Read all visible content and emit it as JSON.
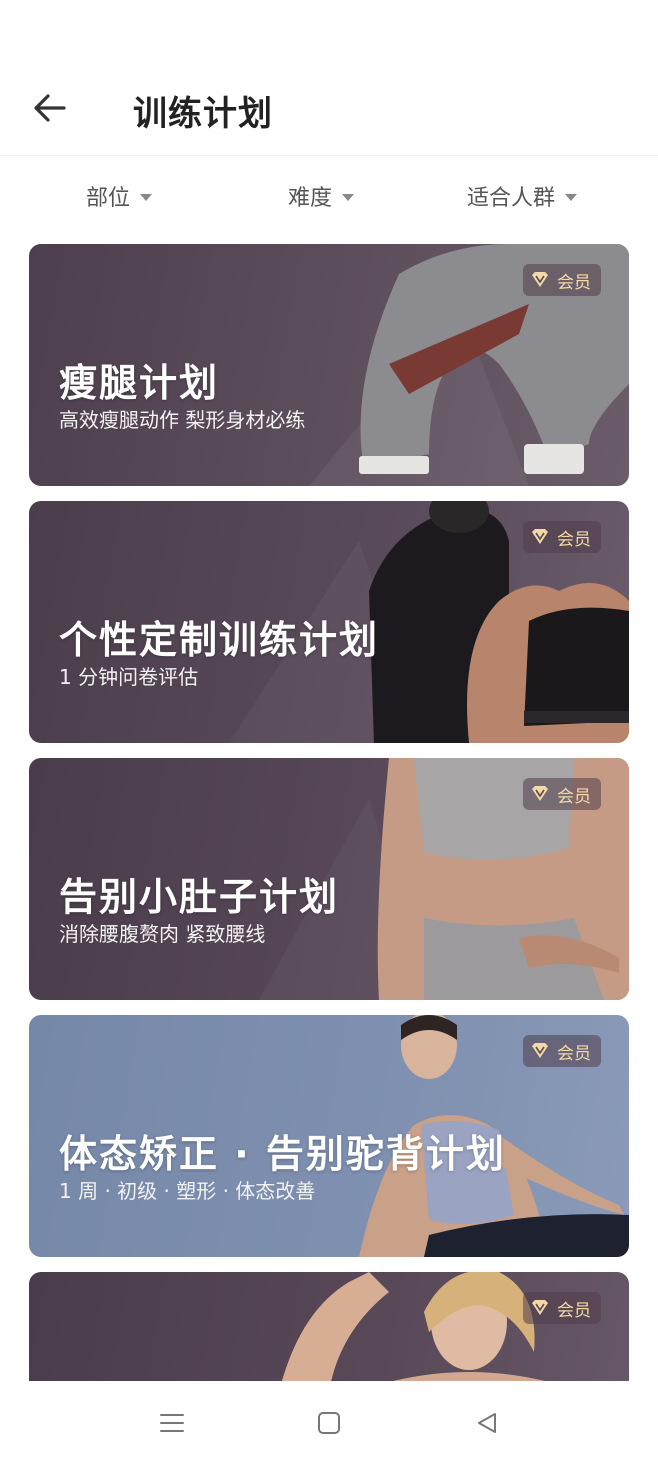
{
  "header": {
    "title": "训练计划",
    "back_icon": "arrow-left-icon"
  },
  "filters": [
    {
      "label": "部位"
    },
    {
      "label": "难度"
    },
    {
      "label": "适合人群"
    }
  ],
  "badge_label": "会员",
  "cards": [
    {
      "title": "瘦腿计划",
      "subtitle": "高效瘦腿动作 梨形身材必练",
      "bg": "#5b4c5a"
    },
    {
      "title": "个性定制训练计划",
      "subtitle": "1 分钟问卷评估",
      "bg": "#564857"
    },
    {
      "title": "告别小肚子计划",
      "subtitle": "消除腰腹赘肉 紧致腰线",
      "bg": "#554555"
    },
    {
      "title": "体态矫正 · 告别驼背计划",
      "subtitle": "1 周 · 初级 · 塑形 · 体态改善",
      "bg": "#7d8fb0"
    },
    {
      "title": "",
      "subtitle": "",
      "bg": "#554555"
    }
  ],
  "colors": {
    "badge_text": "#f3d9a6",
    "badge_bg": "#4a3a47",
    "title_text": "#222222"
  },
  "system_nav": {
    "menu_icon": "menu-icon",
    "home_icon": "square-home-icon",
    "back_icon": "triangle-back-icon"
  }
}
